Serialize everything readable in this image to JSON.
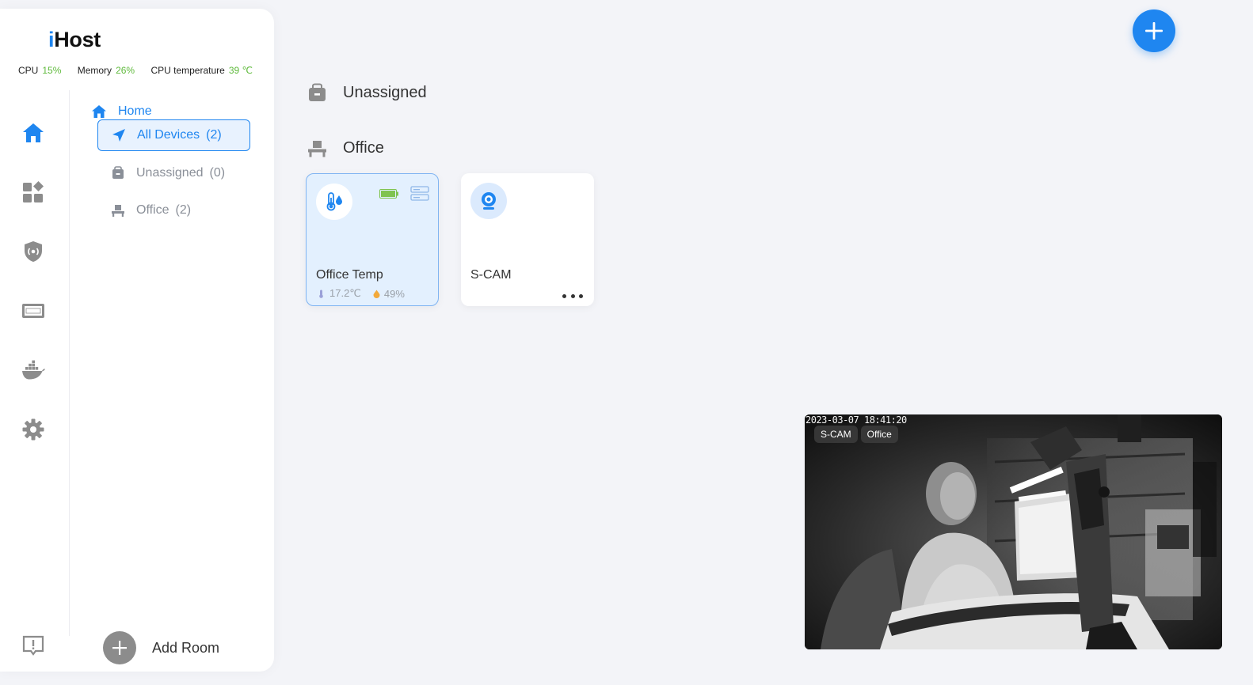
{
  "brand": {
    "prefix": "i",
    "suffix": "Host"
  },
  "stats": {
    "cpu_label": "CPU",
    "cpu_value": "15%",
    "memory_label": "Memory",
    "memory_value": "26%",
    "temp_label": "CPU temperature",
    "temp_value": "39 ℃"
  },
  "nav": {
    "home_label": "Home",
    "rooms": [
      {
        "label": "All Devices",
        "count": "(2)"
      },
      {
        "label": "Unassigned",
        "count": "(0)"
      },
      {
        "label": "Office",
        "count": "(2)"
      }
    ],
    "add_room_label": "Add Room"
  },
  "sections": {
    "unassigned_title": "Unassigned",
    "office_title": "Office"
  },
  "devices": [
    {
      "name": "Office Temp",
      "temperature": "17.2℃",
      "humidity": "49%"
    },
    {
      "name": "S-CAM"
    }
  ],
  "video": {
    "timestamp": "2023-03-07 18:41:20",
    "device_tag": "S-CAM",
    "room_tag": "Office"
  },
  "colors": {
    "accent": "#1f86f0",
    "good": "#5fba3c",
    "muted": "#8a8f98"
  }
}
